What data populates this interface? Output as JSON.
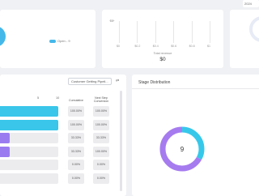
{
  "header": {
    "right_button": "2024"
  },
  "summary_card": {
    "legend_label": "Open - 9"
  },
  "revenue_card": {
    "ticks": [
      "$0",
      "$0.2",
      "$0.4",
      "$0.6",
      "$0.8",
      "$1"
    ],
    "total_label": "Total revenue",
    "total_value": "$0"
  },
  "pipeline": {
    "select_value": "Customer Getting Pipeli...",
    "axis_ticks": [
      "5",
      "10"
    ],
    "col_cumulative": "Cumulative",
    "col_next_step_line1": "Next Step",
    "col_next_step_line2": "Conversion",
    "rows": [
      {
        "fraction": 1.0,
        "color": "#39c6ea",
        "cumulative": "100.00%",
        "next": "100.00%"
      },
      {
        "fraction": 1.0,
        "color": "#39c6ea",
        "cumulative": "100.00%",
        "next": "100.00%"
      },
      {
        "fraction": 0.17,
        "color": "#9b7cf0",
        "cumulative": "33.33%",
        "next": "33.33%"
      },
      {
        "fraction": 0.17,
        "color": "#9b7cf0",
        "cumulative": "33.33%",
        "next": "100.00%"
      },
      {
        "fraction": 0,
        "color": "#ececef",
        "cumulative": "0.00%",
        "next": "0.00%"
      },
      {
        "fraction": 0,
        "color": "#ececef",
        "cumulative": "0.00%",
        "next": "0.00%"
      }
    ]
  },
  "stage_distribution": {
    "title": "Stage Distribution",
    "center_value": "9",
    "segments": [
      {
        "share": 0.33,
        "color": "#36c8ea"
      },
      {
        "share": 0.67,
        "color": "#a67bef"
      }
    ]
  }
}
